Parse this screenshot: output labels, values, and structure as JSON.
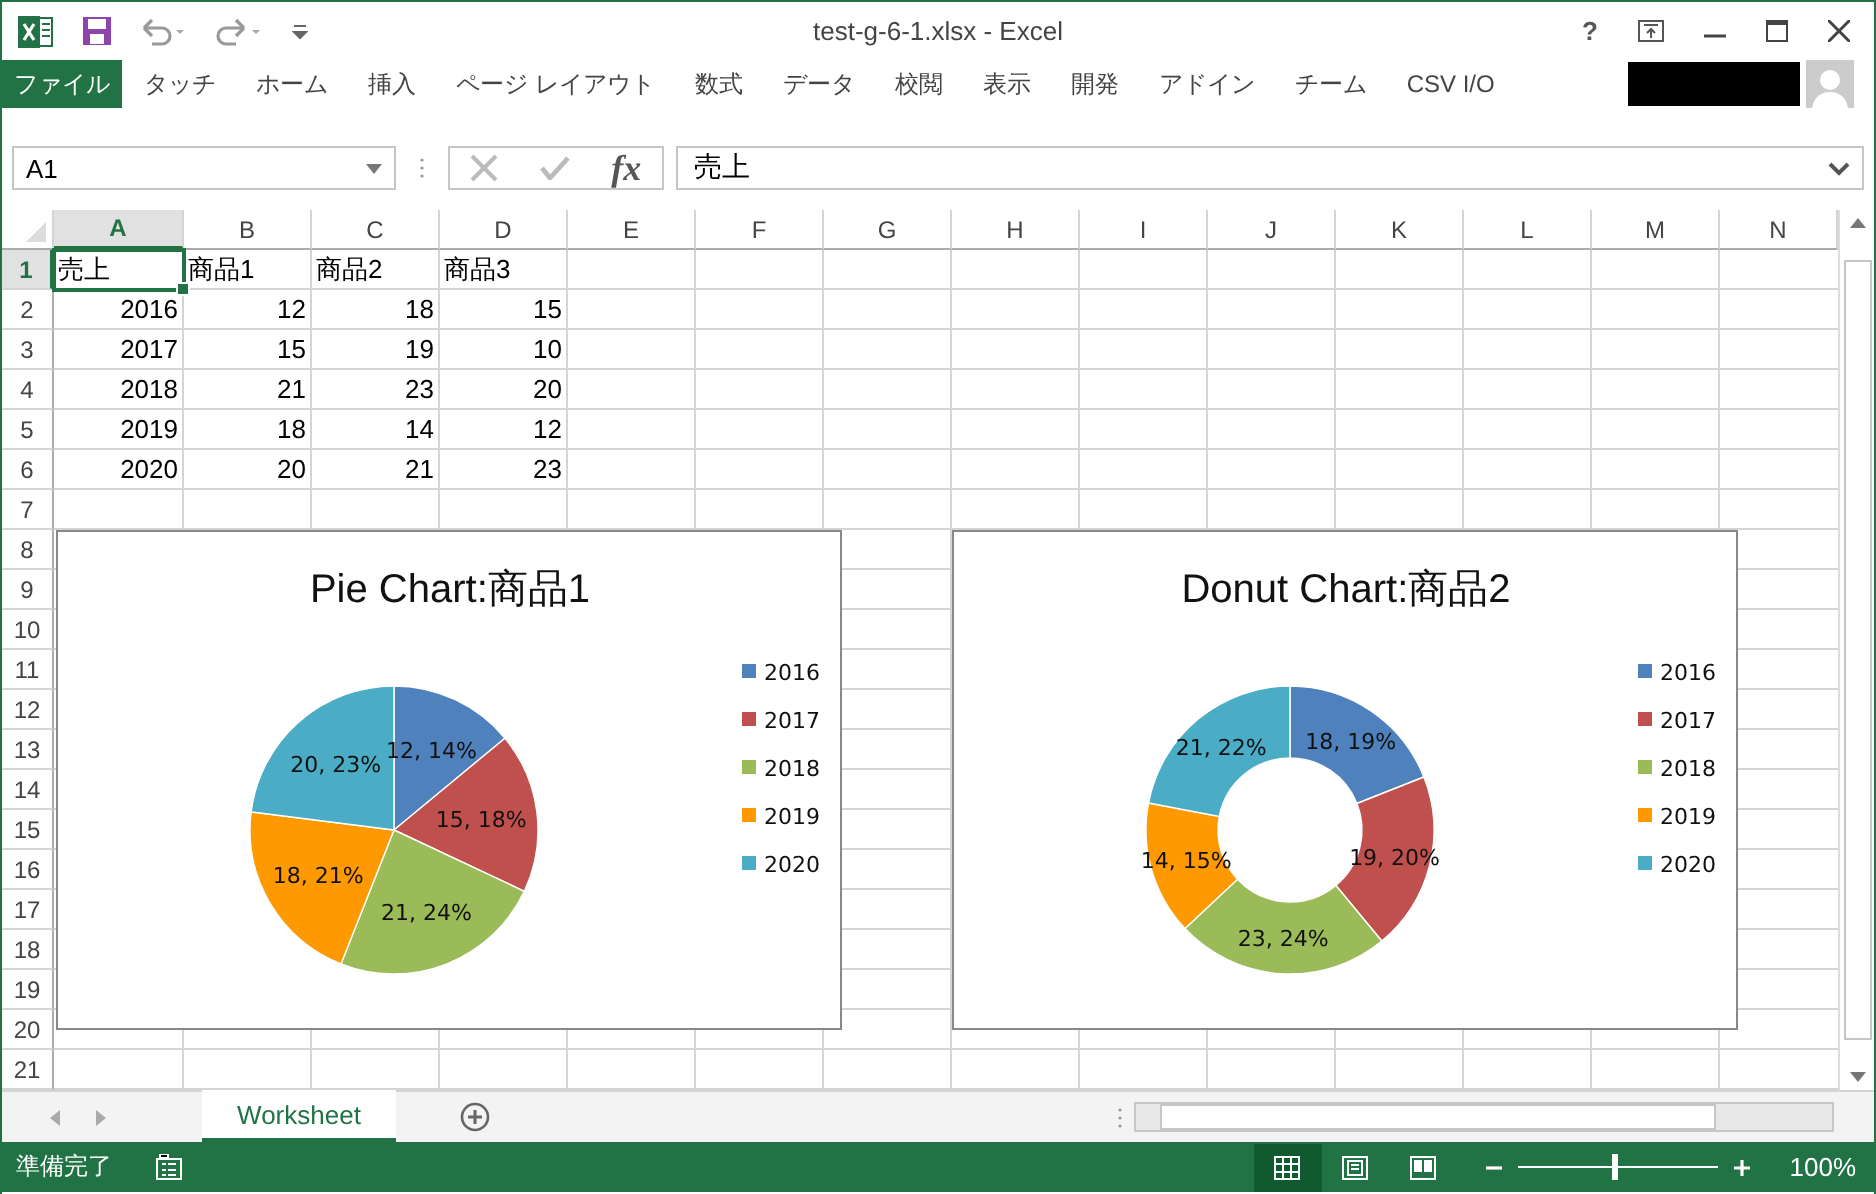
{
  "window": {
    "title": "test-g-6-1.xlsx - Excel",
    "help_label": "?"
  },
  "ribbon": {
    "file_tab": "ファイル",
    "tabs": [
      "タッチ",
      "ホーム",
      "挿入",
      "ページ レイアウト",
      "数式",
      "データ",
      "校閲",
      "表示",
      "開発",
      "アドイン",
      "チーム",
      "CSV I/O"
    ]
  },
  "formula_bar": {
    "name_box": "A1",
    "function_label": "fx",
    "value": "売上"
  },
  "columns": [
    {
      "label": "A",
      "selected": true
    },
    {
      "label": "B",
      "selected": false
    },
    {
      "label": "C",
      "selected": false
    },
    {
      "label": "D",
      "selected": false
    },
    {
      "label": "E",
      "selected": false
    },
    {
      "label": "F",
      "selected": false
    },
    {
      "label": "G",
      "selected": false
    },
    {
      "label": "H",
      "selected": false
    },
    {
      "label": "I",
      "selected": false
    },
    {
      "label": "J",
      "selected": false
    },
    {
      "label": "K",
      "selected": false
    },
    {
      "label": "L",
      "selected": false
    },
    {
      "label": "M",
      "selected": false
    },
    {
      "label": "N",
      "selected": false
    }
  ],
  "rows": [
    {
      "number": "1",
      "selected": true,
      "kind": "text",
      "cells": [
        {
          "text": "売上",
          "selected": true
        },
        {
          "text": "商品1",
          "selected": false
        },
        {
          "text": "商品2",
          "selected": false
        },
        {
          "text": "商品3",
          "selected": false
        }
      ]
    },
    {
      "number": "2",
      "selected": false,
      "kind": "number",
      "cells": [
        {
          "text": "2016",
          "selected": false
        },
        {
          "text": "12",
          "selected": false
        },
        {
          "text": "18",
          "selected": false
        },
        {
          "text": "15",
          "selected": false
        }
      ]
    },
    {
      "number": "3",
      "selected": false,
      "kind": "number",
      "cells": [
        {
          "text": "2017",
          "selected": false
        },
        {
          "text": "15",
          "selected": false
        },
        {
          "text": "19",
          "selected": false
        },
        {
          "text": "10",
          "selected": false
        }
      ]
    },
    {
      "number": "4",
      "selected": false,
      "kind": "number",
      "cells": [
        {
          "text": "2018",
          "selected": false
        },
        {
          "text": "21",
          "selected": false
        },
        {
          "text": "23",
          "selected": false
        },
        {
          "text": "20",
          "selected": false
        }
      ]
    },
    {
      "number": "5",
      "selected": false,
      "kind": "number",
      "cells": [
        {
          "text": "2019",
          "selected": false
        },
        {
          "text": "18",
          "selected": false
        },
        {
          "text": "14",
          "selected": false
        },
        {
          "text": "12",
          "selected": false
        }
      ]
    },
    {
      "number": "6",
      "selected": false,
      "kind": "number",
      "cells": [
        {
          "text": "2020",
          "selected": false
        },
        {
          "text": "20",
          "selected": false
        },
        {
          "text": "21",
          "selected": false
        },
        {
          "text": "23",
          "selected": false
        }
      ]
    },
    {
      "number": "7",
      "selected": false
    },
    {
      "number": "8",
      "selected": false
    },
    {
      "number": "9",
      "selected": false
    },
    {
      "number": "10",
      "selected": false
    },
    {
      "number": "11",
      "selected": false
    },
    {
      "number": "12",
      "selected": false
    },
    {
      "number": "13",
      "selected": false
    },
    {
      "number": "14",
      "selected": false
    },
    {
      "number": "15",
      "selected": false
    },
    {
      "number": "16",
      "selected": false
    },
    {
      "number": "17",
      "selected": false
    },
    {
      "number": "18",
      "selected": false
    },
    {
      "number": "19",
      "selected": false
    },
    {
      "number": "20",
      "selected": false
    },
    {
      "number": "21",
      "selected": false
    }
  ],
  "charts": [
    {
      "chart_data": {
        "type": "pie",
        "title": "Pie Chart:商品1",
        "categories": [
          "2016",
          "2017",
          "2018",
          "2019",
          "2020"
        ],
        "series": [
          {
            "values": [
              14,
              18,
              24,
              21,
              23
            ]
          }
        ],
        "legend": "right",
        "colors": [
          "#4f81bd",
          "#c0504d",
          "#9bbb59",
          "#ff9900",
          "#4bacc6"
        ],
        "value_labels": [
          "12, 14%",
          "15, 18%",
          "21, 24%",
          "18, 21%",
          "20, 23%"
        ]
      }
    },
    {
      "chart_data": {
        "type": "donut",
        "title": "Donut Chart:商品2",
        "categories": [
          "2016",
          "2017",
          "2018",
          "2019",
          "2020"
        ],
        "series": [
          {
            "values": [
              19,
              20,
              24,
              15,
              22
            ]
          }
        ],
        "legend": "right",
        "colors": [
          "#4f81bd",
          "#c0504d",
          "#9bbb59",
          "#ff9900",
          "#4bacc6"
        ],
        "value_labels": [
          "18, 19%",
          "19, 20%",
          "23, 24%",
          "14, 15%",
          "21, 22%"
        ]
      }
    }
  ],
  "sheet_tabs": [
    {
      "label": "Worksheet",
      "selected": true
    }
  ],
  "status_bar": {
    "text": "準備完了",
    "views": [
      {
        "kind": "normal",
        "selected": true
      },
      {
        "kind": "page-layout",
        "selected": false
      },
      {
        "kind": "page-break",
        "selected": false
      }
    ],
    "zoom": {
      "level": 0.48,
      "label": "100%"
    }
  }
}
